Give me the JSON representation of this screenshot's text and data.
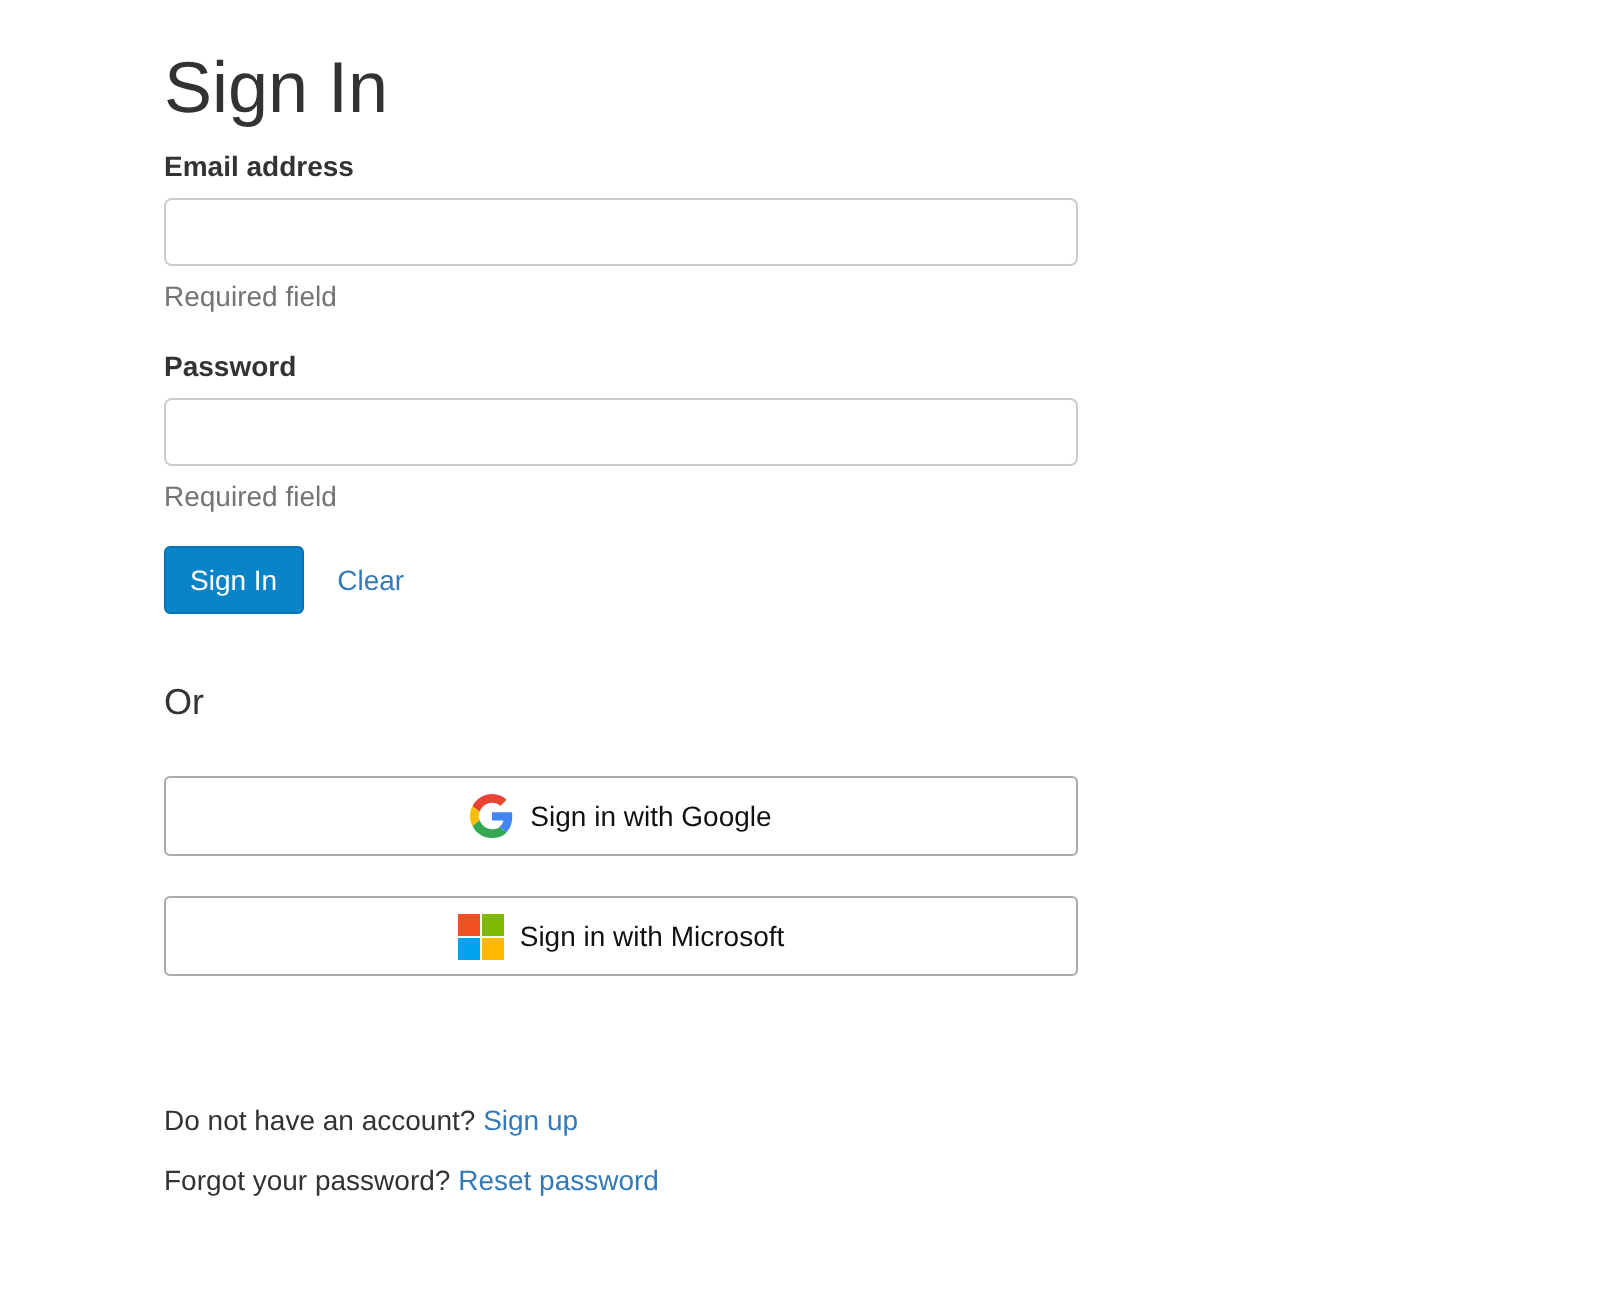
{
  "title": "Sign In",
  "fields": [
    {
      "label": "Email address",
      "help": "Required field"
    },
    {
      "label": "Password",
      "help": "Required field"
    }
  ],
  "actions": {
    "submit": "Sign In",
    "clear": "Clear"
  },
  "divider": "Or",
  "providers": [
    {
      "kind": "google",
      "label": "Sign in with Google"
    },
    {
      "kind": "microsoft",
      "label": "Sign in with Microsoft"
    }
  ],
  "footer": [
    {
      "text": "Do not have an account? ",
      "link": "Sign up"
    },
    {
      "text": "Forgot your password? ",
      "link": "Reset password"
    }
  ]
}
